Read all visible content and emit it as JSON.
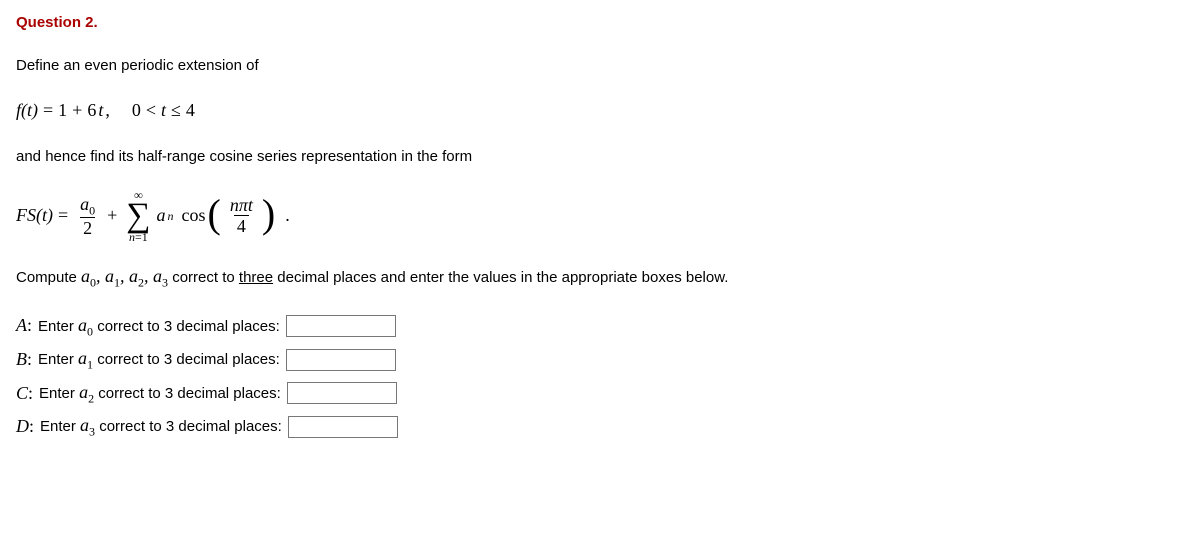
{
  "question": {
    "title": "Question 2.",
    "intro1": "Define an even periodic extension of",
    "func": {
      "lhs": "f(t)",
      "eq": "=",
      "rhs1": "1",
      "plus": "+",
      "rhs2": "6",
      "t": "t",
      "comma": ",",
      "cond_lhs": "0",
      "lt1": "<",
      "tvar": "t",
      "le": "≤",
      "cond_rhs": "4"
    },
    "intro2": "and hence find its half-range cosine series representation in the form",
    "series": {
      "lhs": "FS(t)",
      "a0": "a",
      "a0sub": "0",
      "two": "2",
      "sum_top": "∞",
      "sum_bottom_n": "n",
      "sum_bottom_eq": "=1",
      "an": "a",
      "ansub": "n",
      "cos": "cos",
      "npi": "nπt",
      "four": "4",
      "dot": "."
    },
    "compute_prefix": "Compute ",
    "coeffs_inline": {
      "a": "a",
      "subs": [
        "0",
        "1",
        "2",
        "3"
      ]
    },
    "compute_mid": " correct to ",
    "three": "three",
    "compute_suffix": " decimal places and enter the values in the appropriate boxes below.",
    "answers": [
      {
        "label": "A",
        "coeff_sub": "0",
        "text": "correct to 3 decimal places:"
      },
      {
        "label": "B",
        "coeff_sub": "1",
        "text": "correct to 3 decimal places:"
      },
      {
        "label": "C",
        "coeff_sub": "2",
        "text": "correct to 3 decimal places:"
      },
      {
        "label": "D",
        "coeff_sub": "3",
        "text": "correct to 3 decimal places:"
      }
    ],
    "enter_word": "Enter"
  }
}
